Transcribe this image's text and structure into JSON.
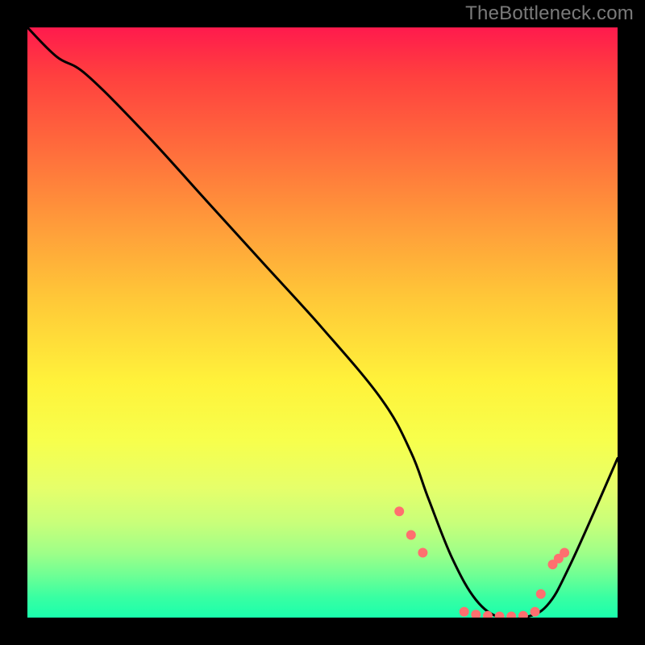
{
  "watermark": "TheBottleneck.com",
  "chart_data": {
    "type": "line",
    "title": "",
    "xlabel": "",
    "ylabel": "",
    "xlim": [
      0,
      100
    ],
    "ylim": [
      0,
      100
    ],
    "series": [
      {
        "name": "curve",
        "x": [
          0,
          5,
          10,
          20,
          30,
          40,
          50,
          60,
          65,
          68,
          72,
          76,
          80,
          84,
          88,
          92,
          100
        ],
        "y": [
          100,
          95,
          92,
          82,
          71,
          60,
          49,
          37,
          28,
          20,
          10,
          3,
          0,
          0,
          2,
          9,
          27
        ]
      }
    ],
    "markers": {
      "name": "dots",
      "x": [
        63,
        65,
        67,
        74,
        76,
        78,
        80,
        82,
        84,
        86,
        87,
        89,
        90,
        91
      ],
      "y": [
        18,
        14,
        11,
        1,
        0.5,
        0.3,
        0.2,
        0.2,
        0.3,
        1,
        4,
        9,
        10,
        11
      ],
      "color": "#ff6f6f",
      "radius": 6
    },
    "colors": {
      "curve": "#000000",
      "frame": "#000000",
      "marker": "#ff6f6f"
    }
  }
}
